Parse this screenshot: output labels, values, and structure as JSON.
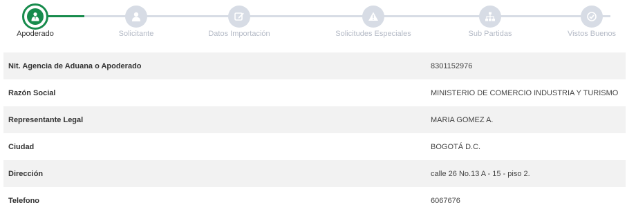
{
  "colors": {
    "accent": "#178b4c",
    "inactive": "#d7dce5",
    "row_alt": "#f2f2f2"
  },
  "steps": [
    {
      "label": "Apoderado",
      "icon": "user-tie-icon",
      "active": true
    },
    {
      "label": "Solicitante",
      "icon": "user-icon",
      "active": false
    },
    {
      "label": "Datos Importación",
      "icon": "edit-icon",
      "active": false
    },
    {
      "label": "Solicitudes Especiales",
      "icon": "warning-icon",
      "active": false
    },
    {
      "label": "Sub Partidas",
      "icon": "sitemap-icon",
      "active": false
    },
    {
      "label": "Vistos Buenos",
      "icon": "check-circle-icon",
      "active": false
    }
  ],
  "rows": [
    {
      "label": "Nit. Agencia de Aduana o Apoderado",
      "value": "8301152976"
    },
    {
      "label": "Razón Social",
      "value": "MINISTERIO DE COMERCIO INDUSTRIA Y TURISMO"
    },
    {
      "label": "Representante Legal",
      "value": "MARIA GOMEZ A."
    },
    {
      "label": "Ciudad",
      "value": "BOGOTÁ D.C."
    },
    {
      "label": "Dirección",
      "value": "calle 26 No.13 A - 15 - piso 2."
    },
    {
      "label": "Telefono",
      "value": "6067676"
    }
  ]
}
